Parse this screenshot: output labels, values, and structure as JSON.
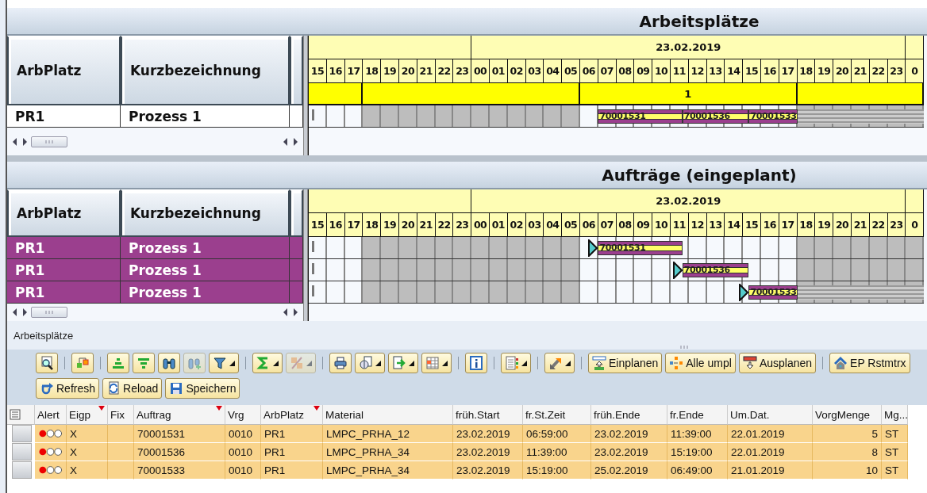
{
  "panels": [
    {
      "title": "Arbeitsplätze",
      "columns": [
        {
          "label": "ArbPlatz"
        },
        {
          "label": "Kurzbezeichnung"
        }
      ],
      "start_markers": false,
      "days": [
        {
          "hours": [
            "15",
            "16",
            "17",
            "18",
            "19",
            "20",
            "21",
            "22",
            "23"
          ]
        },
        {
          "date": "23.02.2019",
          "shift": "1",
          "hours": [
            "00",
            "01",
            "02",
            "03",
            "04",
            "05",
            "06",
            "07",
            "08",
            "09",
            "10",
            "11",
            "12",
            "13",
            "14",
            "15",
            "16",
            "17",
            "18",
            "19",
            "20",
            "21",
            "22",
            "23"
          ]
        },
        {
          "hours": [
            "0"
          ]
        }
      ],
      "rows": [
        {
          "selected": false,
          "cells": [
            "PR1",
            "Prozess 1"
          ],
          "bars": [
            {
              "label": "70001531"
            },
            {
              "label": "70001536"
            },
            {
              "label": "70001533"
            }
          ]
        }
      ]
    },
    {
      "title": "Aufträge (eingeplant)",
      "columns": [
        {
          "label": "ArbPlatz"
        },
        {
          "label": "Kurzbezeichnung"
        }
      ],
      "start_markers": true,
      "days": [
        {
          "hours": [
            "15",
            "16",
            "17",
            "18",
            "19",
            "20",
            "21",
            "22",
            "23"
          ]
        },
        {
          "date": "23.02.2019",
          "hours": [
            "00",
            "01",
            "02",
            "03",
            "04",
            "05",
            "06",
            "07",
            "08",
            "09",
            "10",
            "11",
            "12",
            "13",
            "14",
            "15",
            "16",
            "17",
            "18",
            "19",
            "20",
            "21",
            "22",
            "23"
          ]
        },
        {
          "hours": [
            "0"
          ]
        }
      ],
      "rows": [
        {
          "selected": true,
          "cells": [
            "PR1",
            "Prozess 1"
          ],
          "bars": [
            {
              "label": "70001531"
            }
          ]
        },
        {
          "selected": true,
          "cells": [
            "PR1",
            "Prozess 1"
          ],
          "bars": [
            {
              "label": "70001536"
            }
          ]
        },
        {
          "selected": true,
          "cells": [
            "PR1",
            "Prozess 1"
          ],
          "bars": [
            {
              "label": "70001533"
            }
          ]
        }
      ]
    }
  ],
  "section_label": "Arbeitsplätze",
  "toolbar": [
    {
      "kind": "button",
      "disabled": false
    },
    {
      "kind": "separator"
    },
    {
      "kind": "button",
      "disabled": false
    },
    {
      "kind": "separator"
    },
    {
      "kind": "button",
      "disabled": false
    },
    {
      "kind": "button",
      "disabled": false
    },
    {
      "kind": "button",
      "disabled": false
    },
    {
      "kind": "button",
      "disabled": true
    },
    {
      "kind": "menu",
      "disabled": false
    },
    {
      "kind": "separator"
    },
    {
      "kind": "menu",
      "disabled": false
    },
    {
      "kind": "menu",
      "disabled": true
    },
    {
      "kind": "separator"
    },
    {
      "kind": "button",
      "disabled": false
    },
    {
      "kind": "menu",
      "disabled": false
    },
    {
      "kind": "menu",
      "disabled": false
    },
    {
      "kind": "menu",
      "disabled": false
    },
    {
      "kind": "separator"
    },
    {
      "kind": "button",
      "disabled": false
    },
    {
      "kind": "separator"
    },
    {
      "kind": "menu",
      "disabled": false
    },
    {
      "kind": "separator"
    },
    {
      "kind": "menu",
      "disabled": false
    },
    {
      "kind": "separator"
    },
    {
      "kind": "button",
      "label": "Einplanen",
      "disabled": false
    },
    {
      "kind": "button",
      "label": "Alle umpl",
      "disabled": false
    },
    {
      "kind": "button",
      "label": "Ausplanen",
      "disabled": false
    },
    {
      "kind": "separator"
    },
    {
      "kind": "button",
      "label": "EP Rstmtrx",
      "disabled": false
    }
  ],
  "toolbar_2": [
    {
      "label": "Refresh"
    },
    {
      "label": "Reload"
    },
    {
      "label": "Speichern"
    }
  ],
  "table": {
    "columns": [
      {
        "kind": "lamp",
        "label": "Alert",
        "sorted": false
      },
      {
        "kind": "text",
        "label": "Eigp",
        "sorted": true
      },
      {
        "kind": "blank",
        "label": "Fix",
        "sorted": false
      },
      {
        "kind": "text",
        "label": "Auftrag",
        "sorted": true
      },
      {
        "kind": "text",
        "label": "Vrg",
        "sorted": false
      },
      {
        "kind": "text",
        "label": "ArbPlatz",
        "sorted": true
      },
      {
        "kind": "text",
        "label": "Material",
        "sorted": false
      },
      {
        "kind": "text",
        "label": "früh.Start",
        "sorted": false
      },
      {
        "kind": "text",
        "label": "fr.St.Zeit",
        "sorted": false
      },
      {
        "kind": "text",
        "label": "früh.Ende",
        "sorted": false
      },
      {
        "kind": "text",
        "label": "fr.Ende",
        "sorted": false
      },
      {
        "kind": "text",
        "label": "Um.Dat.",
        "sorted": false
      },
      {
        "kind": "number",
        "label": "VorgMenge",
        "sorted": false
      },
      {
        "kind": "text",
        "label": "Mg...",
        "sorted": false
      }
    ],
    "rows": [
      {
        "color": "#ee0000",
        "cells": [
          "",
          "X",
          "",
          "70001531",
          "0010",
          "PR1",
          "LMPC_PRHA_12",
          "23.02.2019",
          "06:59:00",
          "23.02.2019",
          "11:39:00",
          "22.01.2019",
          "5",
          "ST"
        ]
      },
      {
        "color": "#ee0000",
        "cells": [
          "",
          "X",
          "",
          "70001536",
          "0010",
          "PR1",
          "LMPC_PRHA_34",
          "23.02.2019",
          "11:39:00",
          "23.02.2019",
          "15:19:00",
          "22.01.2019",
          "8",
          "ST"
        ]
      },
      {
        "color": "#ee0000",
        "cells": [
          "",
          "X",
          "",
          "70001533",
          "0010",
          "PR1",
          "LMPC_PRHA_34",
          "23.02.2019",
          "15:19:00",
          "25.02.2019",
          "06:49:00",
          "21.01.2019",
          "10",
          "ST"
        ]
      }
    ]
  }
}
